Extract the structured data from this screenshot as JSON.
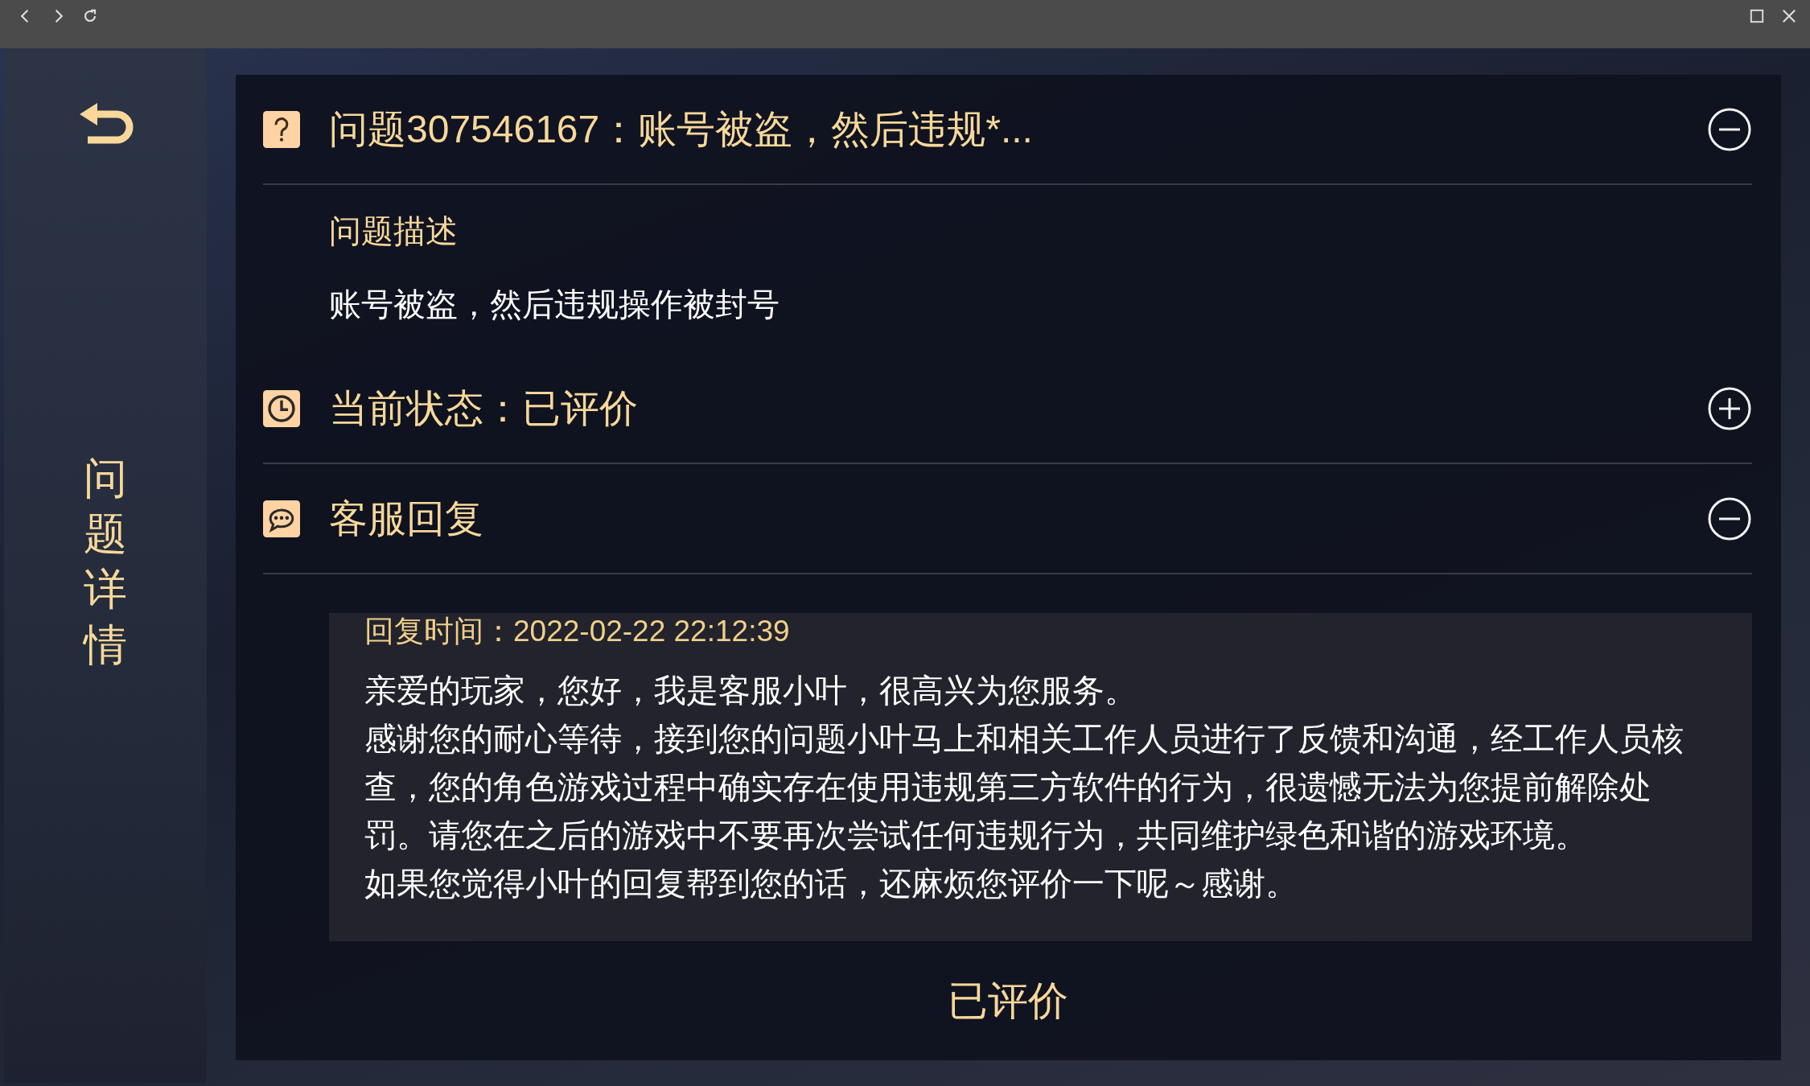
{
  "sidebar": {
    "title": "问题详情"
  },
  "sections": [
    {
      "kind": "question",
      "title": "问题307546167：账号被盗，然后违规*...",
      "expanded": true,
      "label": "问题描述",
      "text": "账号被盗，然后违规操作被封号"
    },
    {
      "kind": "status",
      "title": "当前状态：已评价",
      "expanded": false
    },
    {
      "kind": "reply",
      "title": "客服回复",
      "expanded": true,
      "reply_time": "回复时间：2022-02-22 22:12:39",
      "paragraphs": [
        "亲爱的玩家，您好，我是客服小叶，很高兴为您服务。",
        "感谢您的耐心等待，接到您的问题小叶马上和相关工作人员进行了反馈和沟通，经工作人员核查，您的角色游戏过程中确实存在使用违规第三方软件的行为，很遗憾无法为您提前解除处罚。请您在之后的游戏中不要再次尝试任何违规行为，共同维护绿色和谐的游戏环境。",
        "如果您觉得小叶的回复帮到您的话，还麻烦您评价一下呢～感谢。"
      ]
    }
  ],
  "footer": {
    "rating_status": "已评价"
  }
}
